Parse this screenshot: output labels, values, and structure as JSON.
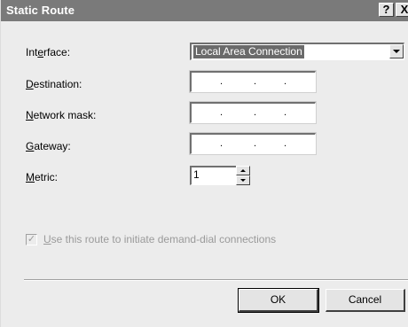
{
  "window": {
    "title": "Static Route",
    "help_button": "?",
    "close_button": "X"
  },
  "form": {
    "interface": {
      "label_pre": "Int",
      "label_key": "e",
      "label_post": "rface:",
      "value": "Local Area Connection"
    },
    "destination": {
      "label_key": "D",
      "label_post": "estination:",
      "value": "   .    .    .   "
    },
    "network_mask": {
      "label_key": "N",
      "label_post": "etwork mask:",
      "value": "   .    .    .   "
    },
    "gateway": {
      "label_key": "G",
      "label_post": "ateway:",
      "value": "   .    .    .   "
    },
    "metric": {
      "label_key": "M",
      "label_post": "etric:",
      "value": "1"
    },
    "demand_dial": {
      "checked": true,
      "enabled": false,
      "label_key": "U",
      "label_post": "se this route to initiate demand-dial connections"
    }
  },
  "buttons": {
    "ok": "OK",
    "cancel": "Cancel"
  },
  "colors": {
    "titlebar": "#7a7a7a",
    "dialog_bg": "#ececec",
    "selection": "#6a6a6a",
    "disabled_text": "#9a9a9a"
  },
  "icons": {
    "dropdown": "chevron-down-icon",
    "spin_up": "spin-up-icon",
    "spin_down": "spin-down-icon",
    "check": "checkmark-icon"
  }
}
